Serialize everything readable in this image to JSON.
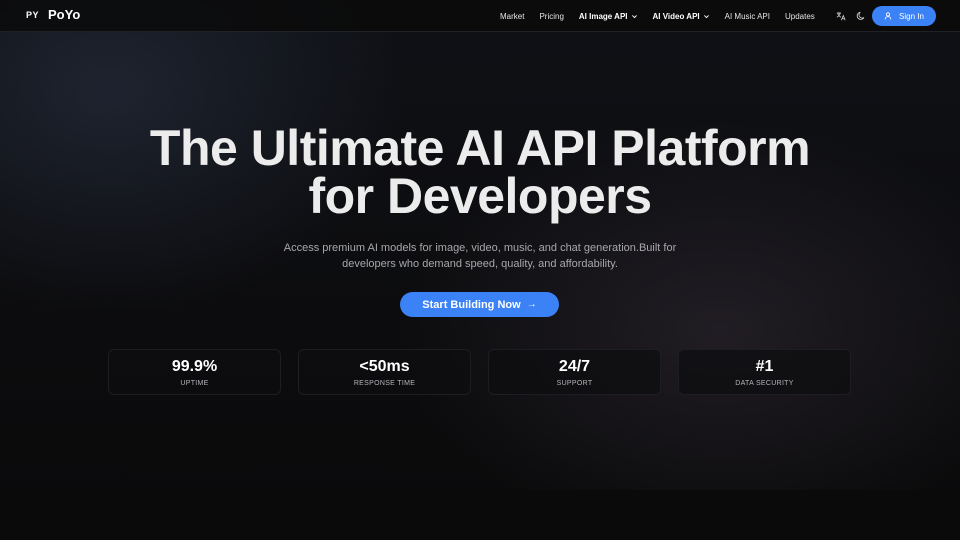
{
  "brand": {
    "mark": "PY",
    "name": "PoYo"
  },
  "nav": {
    "items": [
      {
        "label": "Market",
        "dropdown": false
      },
      {
        "label": "Pricing",
        "dropdown": false
      },
      {
        "label": "AI Image API",
        "dropdown": true
      },
      {
        "label": "AI Video API",
        "dropdown": true
      },
      {
        "label": "AI Music API",
        "dropdown": false
      },
      {
        "label": "Updates",
        "dropdown": false
      }
    ],
    "icons": {
      "language": "translate-icon",
      "theme": "moon-icon",
      "user": "user-icon"
    },
    "sign_in_label": "Sign In"
  },
  "hero": {
    "title_line1": "The Ultimate AI API Platform",
    "title_line2": "for Developers",
    "subtitle_line1": "Access premium AI models for image, video, music, and chat generation.Built for",
    "subtitle_line2": "developers who demand speed, quality, and affordability.",
    "cta_label": "Start Building Now",
    "cta_arrow": "→"
  },
  "stats": [
    {
      "value": "99.9%",
      "label": "UPTIME"
    },
    {
      "value": "<50ms",
      "label": "RESPONSE TIME"
    },
    {
      "value": "24/7",
      "label": "SUPPORT"
    },
    {
      "value": "#1",
      "label": "DATA SECURITY"
    }
  ],
  "colors": {
    "accent": "#3b82f6",
    "background": "#0a0a0b",
    "title": "#ececec",
    "muted": "#a8a8ac"
  }
}
